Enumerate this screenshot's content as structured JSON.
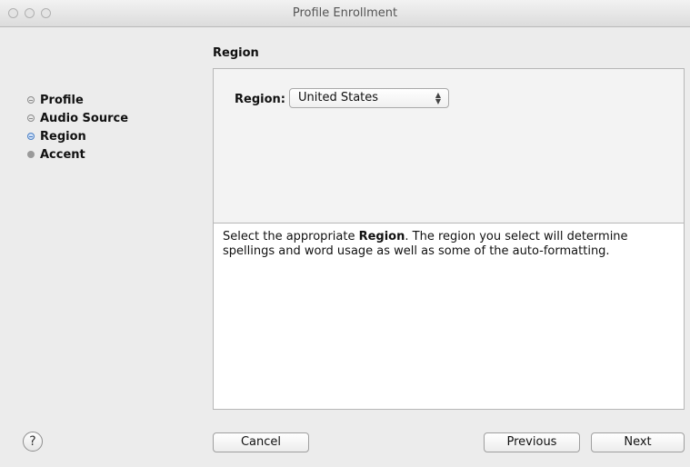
{
  "window": {
    "title": "Profile Enrollment"
  },
  "steps": [
    {
      "label": "Profile",
      "state": "done"
    },
    {
      "label": "Audio Source",
      "state": "done"
    },
    {
      "label": "Region",
      "state": "current"
    },
    {
      "label": "Accent",
      "state": "todo"
    }
  ],
  "section": {
    "title": "Region"
  },
  "region": {
    "label": "Region:",
    "selected": "United States"
  },
  "help": {
    "text_before": "Select the appropriate ",
    "text_bold": "Region",
    "text_after": ". The region you select will determine spellings and word usage as well as some of the auto-formatting.",
    "button_label": "?"
  },
  "buttons": {
    "cancel": "Cancel",
    "previous": "Previous",
    "next": "Next"
  },
  "colors": {
    "current_step": "#4a7fc4",
    "todo_step": "#9a9a9a"
  }
}
